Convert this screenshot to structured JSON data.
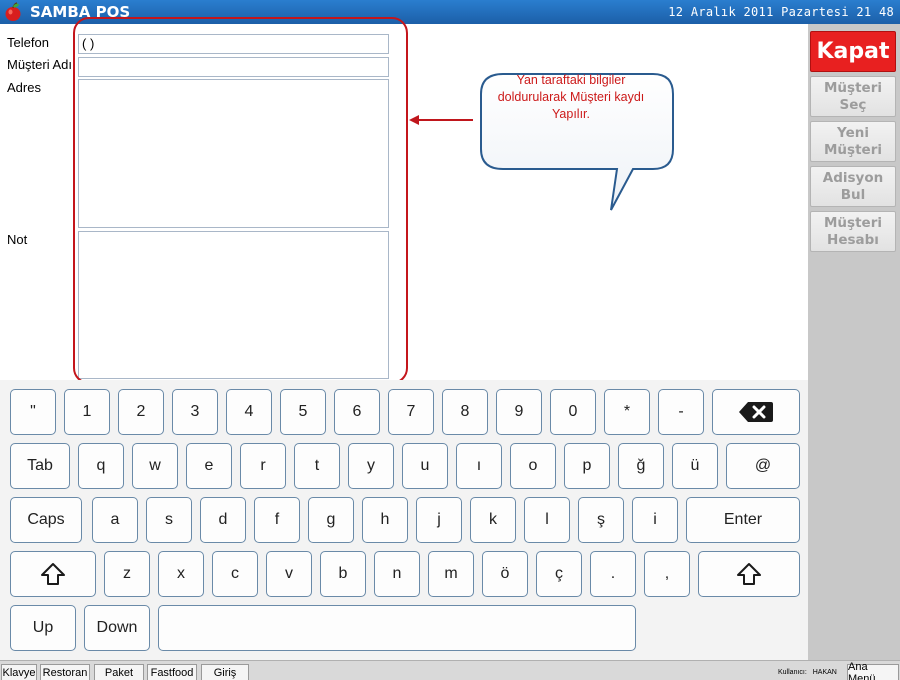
{
  "header": {
    "app_title": "SAMBA POS",
    "datetime": "12 Aralık 2011 Pazartesi 21 48",
    "logo_icon": "apple-logo-icon"
  },
  "form": {
    "telefon_label": "Telefon",
    "telefon_value": "(   )",
    "musteri_adi_label": "Müşteri Adı",
    "musteri_adi_value": "",
    "adres_label": "Adres",
    "adres_value": "",
    "not_label": "Not",
    "not_value": ""
  },
  "callout": {
    "text": "Yan taraftaki bilgiler doldurularak Müşteri kaydı Yapılır.",
    "color": "#cc1a1a"
  },
  "sidebar": {
    "close_label": "Kapat",
    "buttons": [
      "Müşteri Seç",
      "Yeni Müşteri",
      "Adisyon Bul",
      "Müşteri Hesabı"
    ]
  },
  "keyboard": {
    "row1": [
      "\"",
      "1",
      "2",
      "3",
      "4",
      "5",
      "6",
      "7",
      "8",
      "9",
      "0",
      "*",
      "-"
    ],
    "backspace_icon": "backspace-icon",
    "row2": [
      "Tab",
      "q",
      "w",
      "e",
      "r",
      "t",
      "y",
      "u",
      "ı",
      "o",
      "p",
      "ğ",
      "ü",
      "@"
    ],
    "row3": [
      "Caps",
      "a",
      "s",
      "d",
      "f",
      "g",
      "h",
      "j",
      "k",
      "l",
      "ş",
      "i",
      "Enter"
    ],
    "row4": [
      "z",
      "x",
      "c",
      "v",
      "b",
      "n",
      "m",
      "ö",
      "ç",
      ".",
      ","
    ],
    "shift_icon": "shift-arrow-icon",
    "row5": [
      "Up",
      "Down"
    ]
  },
  "taskbar": {
    "buttons": [
      "Klavye",
      "Restoran",
      "Paket",
      "Fastfood",
      "Giriş"
    ],
    "user_label": "Kullanıcı:",
    "user_name": "HAKAN",
    "main_menu": "Ana Menü"
  }
}
